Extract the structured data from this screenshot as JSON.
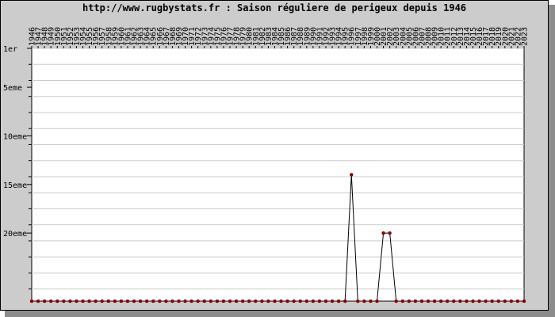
{
  "title": "http://www.rugbystats.fr : Saison réguliere de perigeux depuis 1946",
  "colors": {
    "frame_bg": "#cccccc",
    "plot_bg": "#ffffff",
    "grid": "#cccccc",
    "line": "#000000",
    "marker": "#8b0000"
  },
  "chart_data": {
    "type": "line",
    "title": "http://www.rugbystats.fr : Saison réguliere de perigeux depuis 1946",
    "xlabel": "",
    "ylabel": "",
    "x": [
      1946,
      1947,
      1948,
      1949,
      1950,
      1951,
      1952,
      1953,
      1954,
      1955,
      1956,
      1957,
      1958,
      1959,
      1960,
      1961,
      1962,
      1963,
      1964,
      1965,
      1966,
      1967,
      1968,
      1969,
      1970,
      1971,
      1972,
      1973,
      1974,
      1975,
      1976,
      1977,
      1978,
      1979,
      1980,
      1981,
      1982,
      1983,
      1984,
      1985,
      1986,
      1987,
      1988,
      1989,
      1990,
      1991,
      1992,
      1993,
      1994,
      1995,
      1996,
      1997,
      1998,
      1999,
      2000,
      2001,
      2002,
      2003,
      2004,
      2005,
      2006,
      2007,
      2008,
      2009,
      2010,
      2011,
      2012,
      2013,
      2014,
      2015,
      2016,
      2017,
      2018,
      2019,
      2020,
      2021,
      2022,
      2023
    ],
    "x_tick_labels": [
      "1946",
      "1947",
      "1948",
      "1949",
      "1950",
      "1951",
      "1952",
      "1953",
      "1954",
      "1955",
      "1956",
      "1957",
      "1958",
      "1959",
      "1960",
      "1961",
      "1962",
      "1963",
      "1964",
      "1965",
      "1966",
      "1967",
      "1968",
      "1969",
      "1970",
      "1971",
      "1972",
      "1973",
      "1974",
      "1975",
      "1976",
      "1977",
      "1978",
      "1979",
      "1980",
      "1981",
      "1982",
      "1983",
      "1984",
      "1985",
      "1986",
      "1987",
      "1988",
      "1989",
      "1990",
      "1991",
      "1992",
      "1993",
      "1994",
      "1995",
      "1996",
      "1997",
      "1998",
      "1999",
      "2000",
      "2001",
      "2002",
      "2003",
      "2004",
      "2005",
      "2006",
      "2007",
      "2008",
      "2009",
      "2010",
      "2011",
      "2012",
      "2013",
      "2014",
      "2015",
      "2016",
      "2017",
      "2018",
      "2019",
      "2020",
      "2021",
      "2022",
      "2023"
    ],
    "series": [
      {
        "values": [
          null,
          null,
          null,
          null,
          null,
          null,
          null,
          null,
          null,
          null,
          null,
          null,
          null,
          null,
          null,
          null,
          null,
          null,
          null,
          null,
          null,
          null,
          null,
          null,
          null,
          null,
          null,
          null,
          null,
          null,
          null,
          null,
          null,
          null,
          null,
          null,
          null,
          null,
          null,
          null,
          null,
          null,
          null,
          null,
          null,
          null,
          null,
          null,
          null,
          null,
          14,
          null,
          null,
          null,
          null,
          20,
          20,
          null,
          null,
          null,
          null,
          null,
          null,
          null,
          null,
          null,
          null,
          null,
          null,
          null,
          null,
          null,
          null,
          null,
          null,
          null,
          null,
          null
        ],
        "note_none": "null values are shown at the bottom baseline (not classified)"
      }
    ],
    "y_axis": {
      "inverted": true,
      "range": [
        1,
        27
      ],
      "tick_labels": [
        {
          "value": 1,
          "label": "1er"
        },
        {
          "value": 5,
          "label": "5eme"
        },
        {
          "value": 10,
          "label": "10eme"
        },
        {
          "value": 15,
          "label": "15eme"
        },
        {
          "value": 20,
          "label": "20eme"
        }
      ],
      "grid_every": 1.65
    },
    "grid": true
  }
}
